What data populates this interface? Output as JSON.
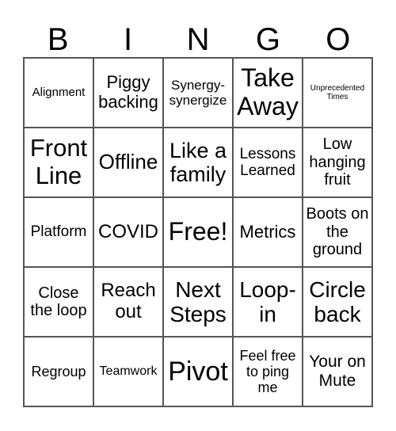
{
  "header": {
    "letters": [
      "B",
      "I",
      "N",
      "G",
      "O"
    ]
  },
  "cells": [
    "Alignment",
    "Piggy backing",
    "Synergy-synergize",
    "Take Away",
    "Unprecedented Times",
    "Front Line",
    "Offline",
    "Like a family",
    "Lessons Learned",
    "Low hanging fruit",
    "Platform",
    "COVID",
    "Free!",
    "Metrics",
    "Boots on the ground",
    "Close the loop",
    "Reach out",
    "Next Steps",
    "Loop-in",
    "Circle back",
    "Regroup",
    "Teamwork",
    "Pivot",
    "Feel free to ping me",
    "Your on Mute"
  ]
}
